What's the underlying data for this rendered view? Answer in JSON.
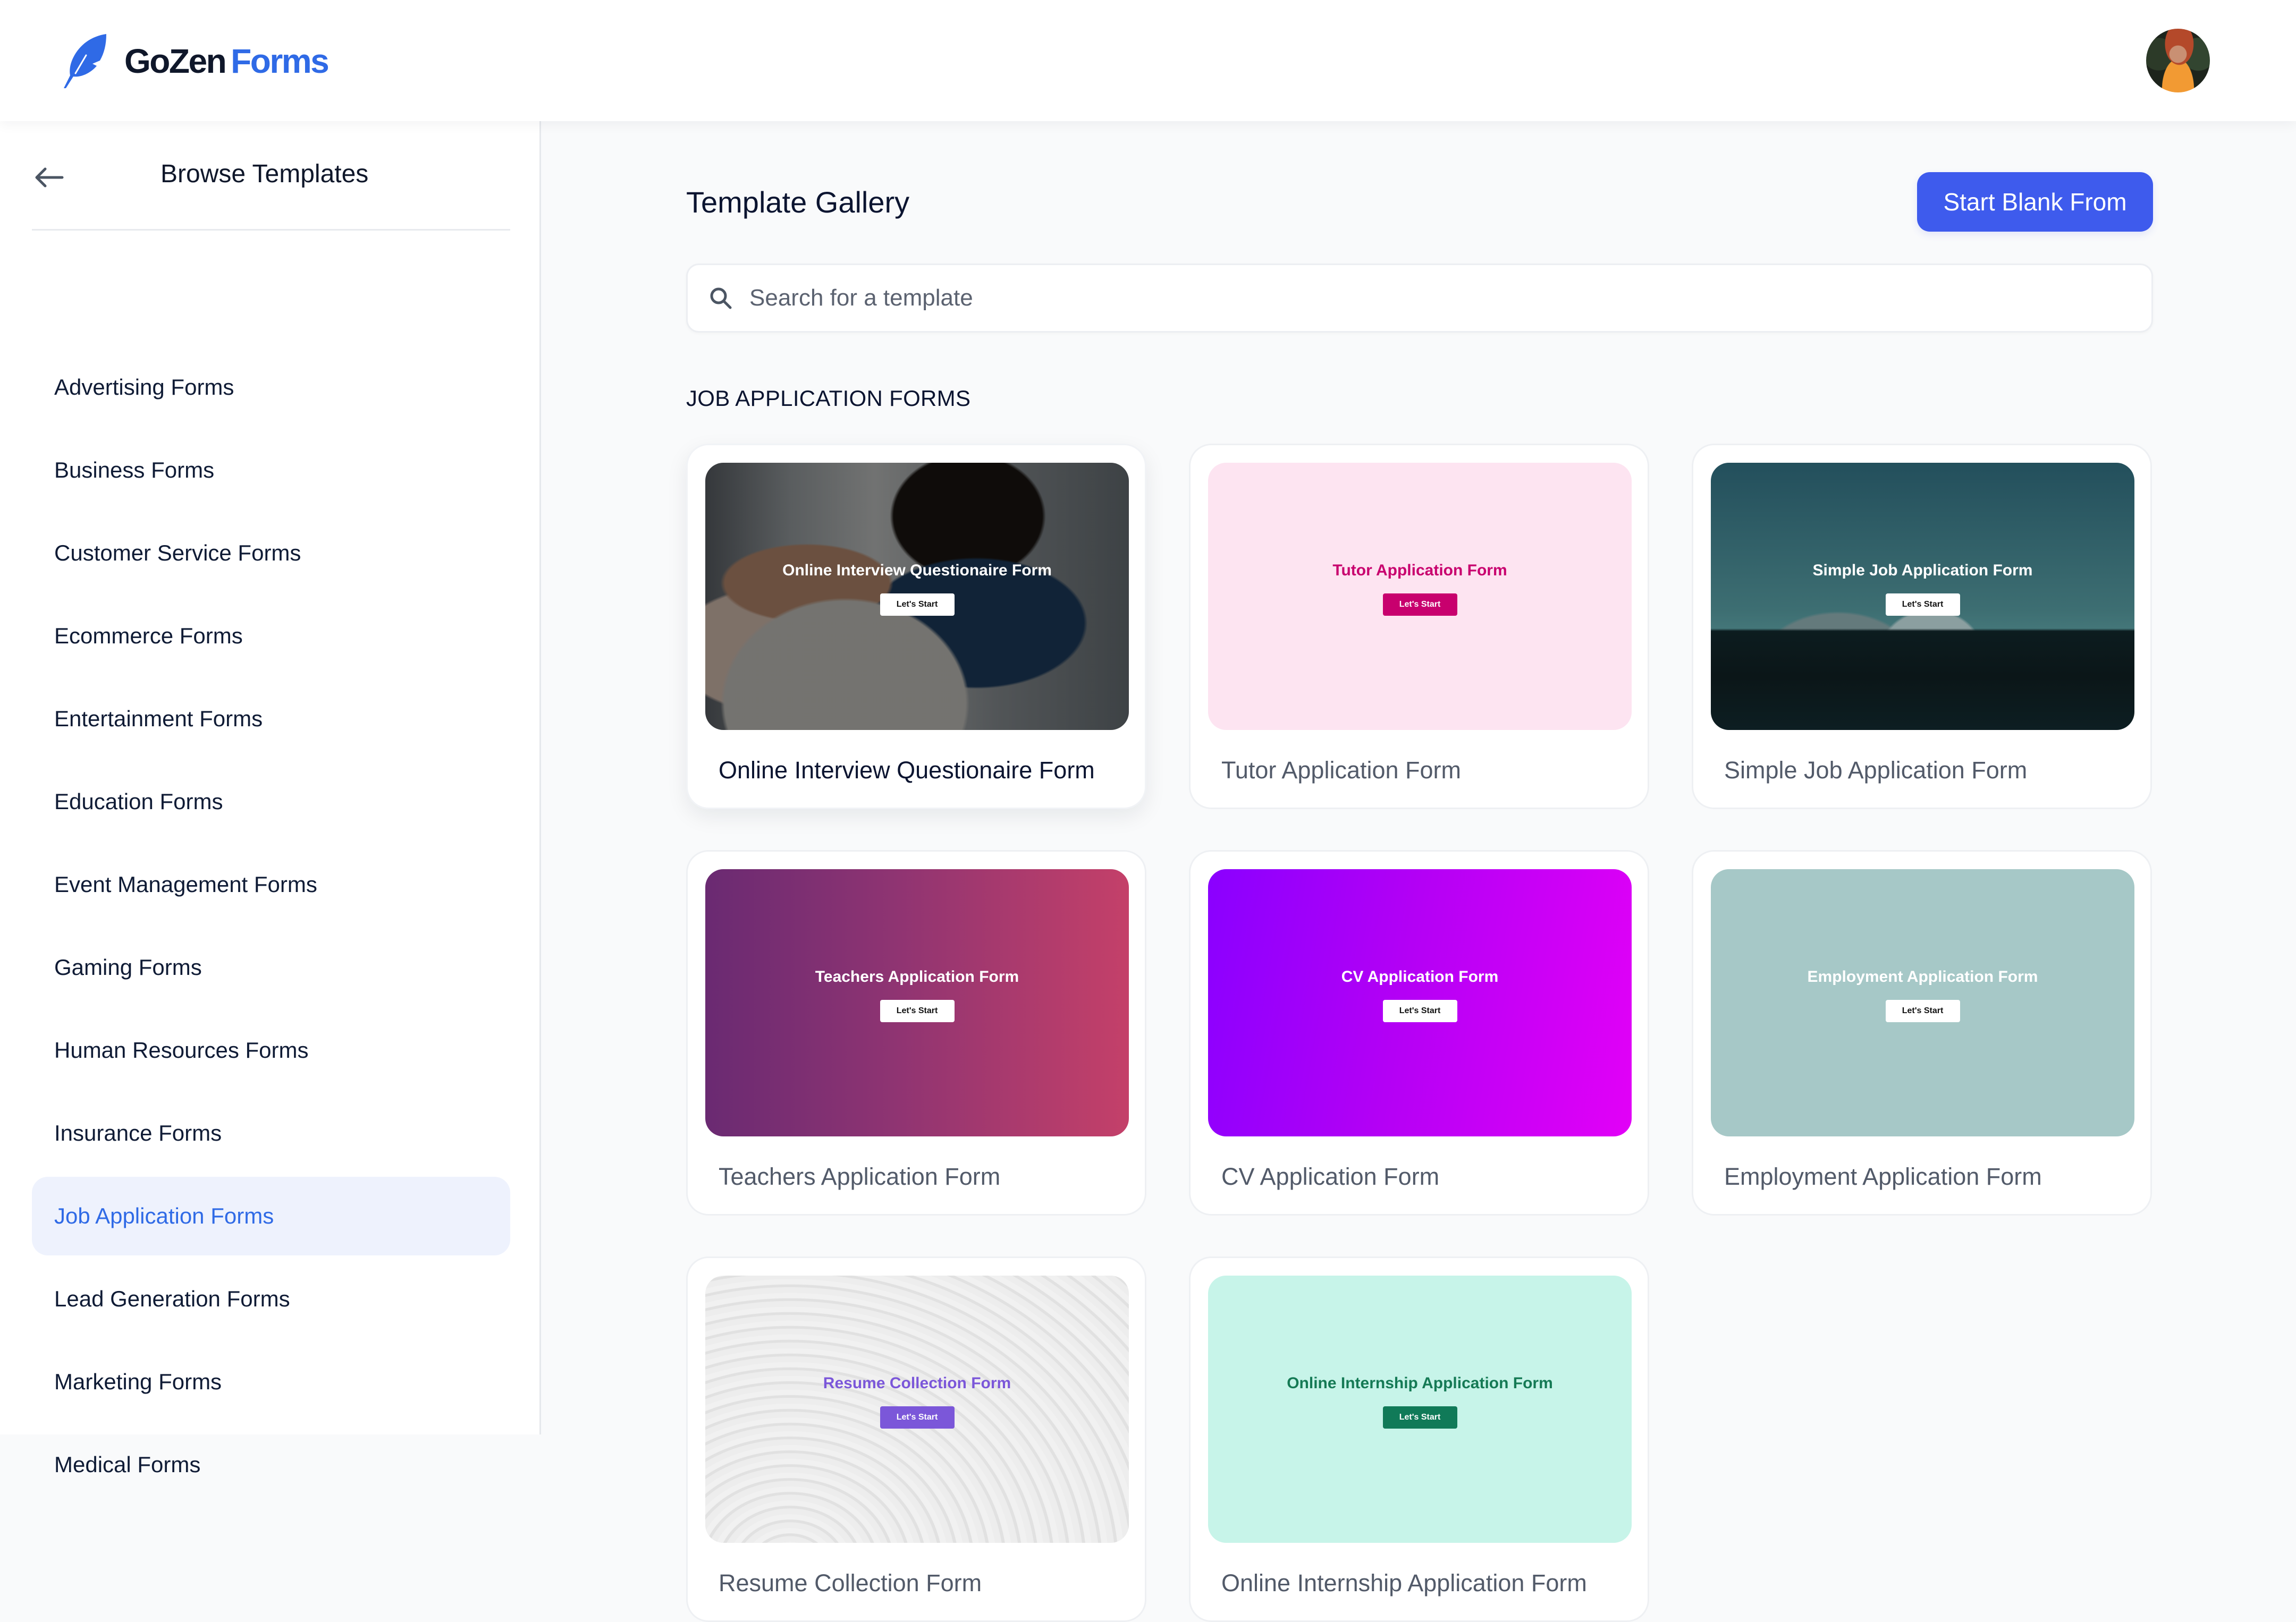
{
  "header": {
    "brand": {
      "name_part1": "GoZen",
      "name_part2": "Forms",
      "logo_icon": "feather-icon",
      "color": "#2f6ae6"
    },
    "avatar": {
      "alt": "User profile photo"
    }
  },
  "sidebar": {
    "back_icon": "arrow-left-icon",
    "title": "Browse Templates",
    "active_index": 10,
    "items": [
      {
        "label": "Advertising Forms"
      },
      {
        "label": "Business Forms"
      },
      {
        "label": "Customer Service Forms"
      },
      {
        "label": "Ecommerce Forms"
      },
      {
        "label": "Entertainment Forms"
      },
      {
        "label": "Education Forms"
      },
      {
        "label": "Event Management Forms"
      },
      {
        "label": "Gaming Forms"
      },
      {
        "label": "Human Resources Forms"
      },
      {
        "label": "Insurance Forms"
      },
      {
        "label": "Job Application Forms"
      },
      {
        "label": "Lead Generation Forms"
      },
      {
        "label": "Marketing Forms"
      },
      {
        "label": "Medical Forms"
      }
    ]
  },
  "main": {
    "title": "Template Gallery",
    "start_blank_label": "Start Blank From",
    "search": {
      "placeholder": "Search for a template",
      "value": "",
      "icon": "search-icon"
    },
    "section_label": "JOB APPLICATION FORMS",
    "templates": [
      {
        "title": "Online Interview Questionaire Form",
        "preview_title": "Online Interview Questionaire Form",
        "button_label": "Let's Start",
        "theme": "photo-interview",
        "title_color": "#ffffff",
        "button_bg": "#ffffff",
        "button_color": "#111111"
      },
      {
        "title": "Tutor Application Form",
        "preview_title": "Tutor Application Form",
        "button_label": "Let's Start",
        "theme": "solid-pink",
        "title_color": "#c8006e",
        "button_bg": "#c8006e",
        "button_color": "#ffffff"
      },
      {
        "title": "Simple Job Application Form",
        "preview_title": "Simple Job Application Form",
        "button_label": "Let's Start",
        "theme": "photo-mountain",
        "title_color": "#ffffff",
        "button_bg": "#ffffff",
        "button_color": "#111111"
      },
      {
        "title": "Teachers Application Form",
        "preview_title": "Teachers Application Form",
        "button_label": "Let's Start",
        "theme": "gradient-plum",
        "title_color": "#ffffff",
        "button_bg": "#ffffff",
        "button_color": "#111111"
      },
      {
        "title": "CV Application Form",
        "preview_title": "CV Application Form",
        "button_label": "Let's Start",
        "theme": "gradient-violet",
        "title_color": "#ffffff",
        "button_bg": "#ffffff",
        "button_color": "#111111"
      },
      {
        "title": "Employment Application Form",
        "preview_title": "Employment Application Form",
        "button_label": "Let's Start",
        "theme": "solid-sage",
        "title_color": "#ffffff",
        "button_bg": "#ffffff",
        "button_color": "#111111"
      },
      {
        "title": "Resume Collection Form",
        "preview_title": "Resume Collection Form",
        "button_label": "Let's Start",
        "theme": "texture-white",
        "title_color": "#7b57d9",
        "button_bg": "#7b57d9",
        "button_color": "#ffffff"
      },
      {
        "title": "Online Internship Application Form",
        "preview_title": "Online Internship Application Form",
        "button_label": "Let's Start",
        "theme": "solid-mint",
        "title_color": "#157a55",
        "button_bg": "#107a58",
        "button_color": "#ffffff"
      }
    ]
  },
  "colors": {
    "accent": "#3e5bed",
    "active_nav_bg": "#eef2fd",
    "active_nav_text": "#2f6ae6",
    "page_bg": "#f9fafb"
  }
}
